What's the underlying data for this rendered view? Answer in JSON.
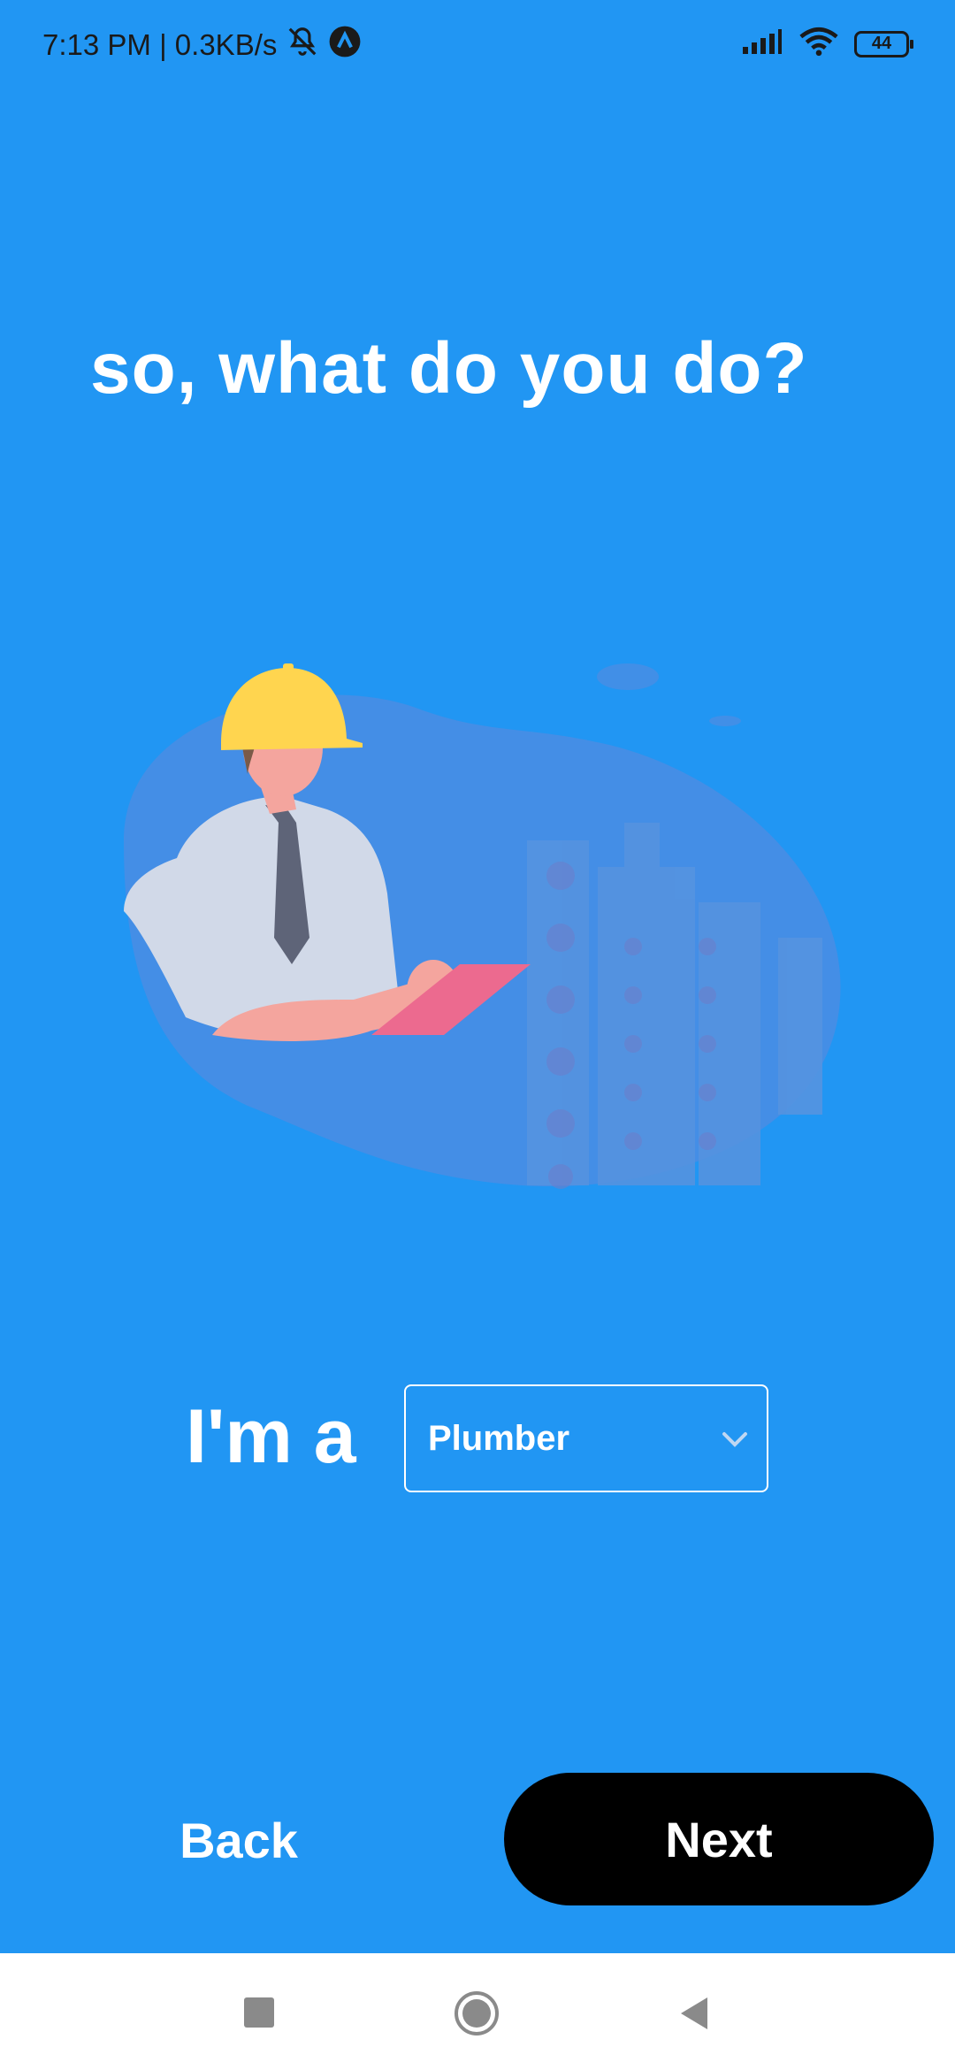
{
  "status_bar": {
    "time_speed": "7:13 PM | 0.3KB/s",
    "battery": "44",
    "icons": [
      "bell-off-icon",
      "app-a-icon",
      "signal-icon",
      "wifi-icon",
      "battery-icon"
    ]
  },
  "title": "so, what do you do?",
  "illustration": "worker-with-tablet-illustration",
  "role": {
    "prefix": "I'm a",
    "selected": "Plumber"
  },
  "buttons": {
    "back": "Back",
    "next": "Next"
  },
  "nav": {
    "icons": [
      "recents-square-icon",
      "home-circle-icon",
      "back-triangle-icon"
    ]
  },
  "colors": {
    "background": "#2196F3",
    "primary_button": "#000000",
    "text": "#ffffff"
  }
}
